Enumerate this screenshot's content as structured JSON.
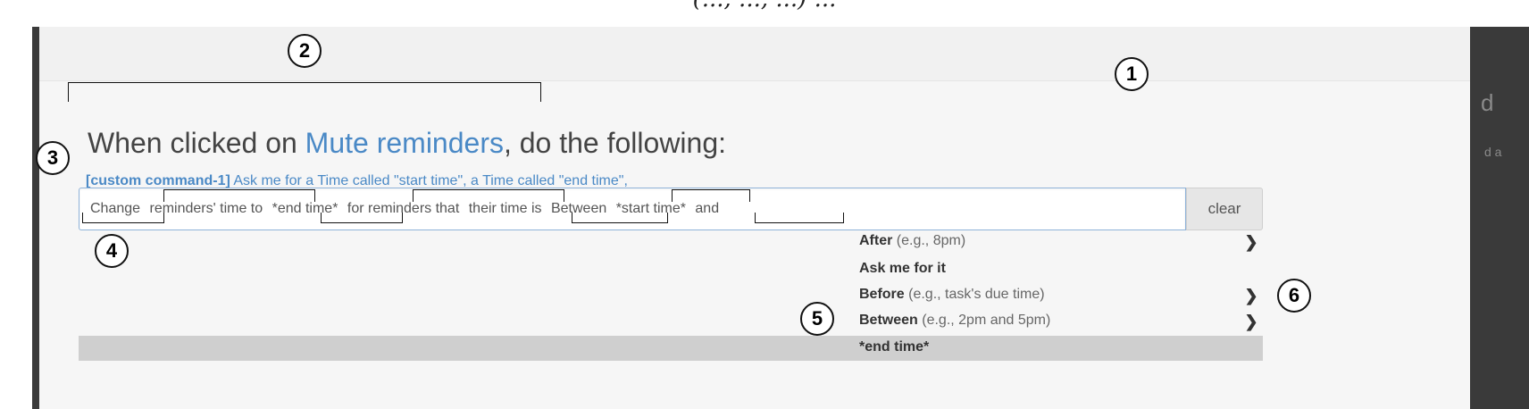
{
  "caption_fragment": "(..., ..., ...) ...",
  "heading": {
    "prefix": "When clicked on ",
    "link": "Mute reminders",
    "suffix": ", do the following:"
  },
  "command": {
    "tag": "[custom command-1]",
    "text": " Ask me for a Time called \"start time\", a Time called \"end time\","
  },
  "input": {
    "tokens": [
      "Change",
      "reminders' time to",
      "*end time*",
      "for reminders that",
      "their time is",
      "Between",
      "*start time*",
      "and"
    ]
  },
  "clear_label": "clear",
  "dropdown": [
    {
      "label": "After",
      "hint": " (e.g., 8pm)",
      "has_submenu": true
    },
    {
      "label": "Ask me for it",
      "hint": "",
      "has_submenu": false
    },
    {
      "label": "Before",
      "hint": " (e.g., task's due time)",
      "has_submenu": true
    },
    {
      "label": "Between",
      "hint": " (e.g., 2pm and 5pm)",
      "has_submenu": true
    },
    {
      "label": "*end time*",
      "hint": "",
      "has_submenu": false
    }
  ],
  "callouts": [
    "1",
    "2",
    "3",
    "4",
    "5",
    "6"
  ],
  "background_right_text": "d",
  "background_right_text2": "d a"
}
